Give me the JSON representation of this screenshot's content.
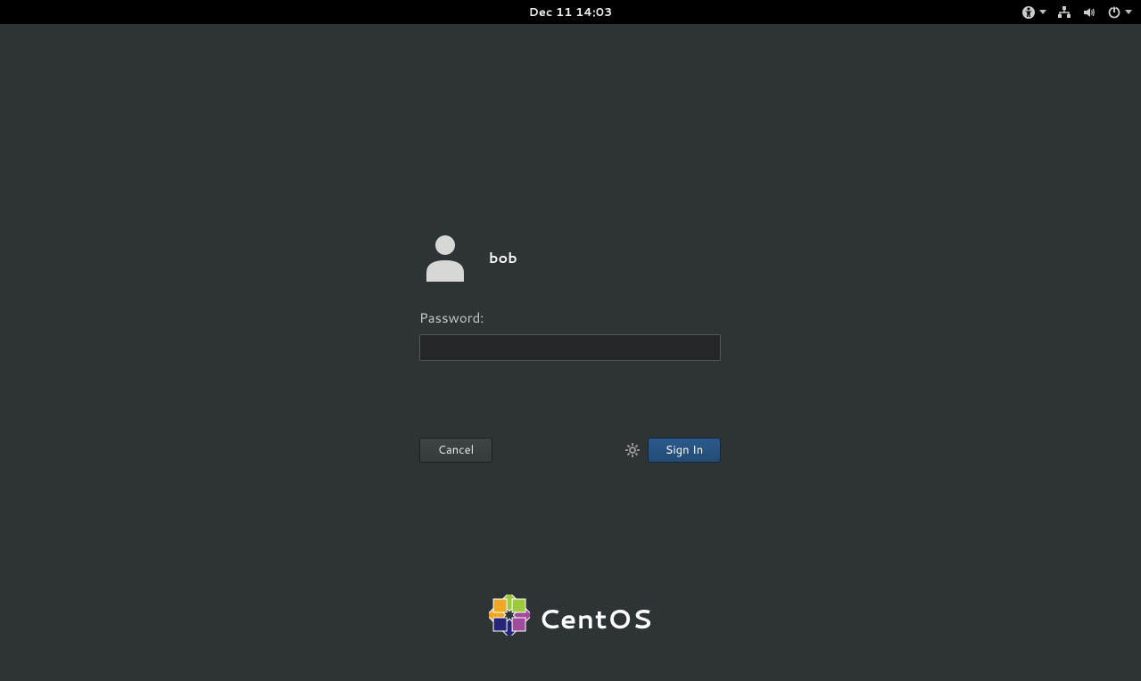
{
  "topbar": {
    "datetime": "Dec 11  14:03"
  },
  "login": {
    "username": "bob",
    "password_label": "Password:",
    "password_value": "",
    "cancel_label": "Cancel",
    "signin_label": "Sign In"
  },
  "branding": {
    "name": "CentOS"
  }
}
